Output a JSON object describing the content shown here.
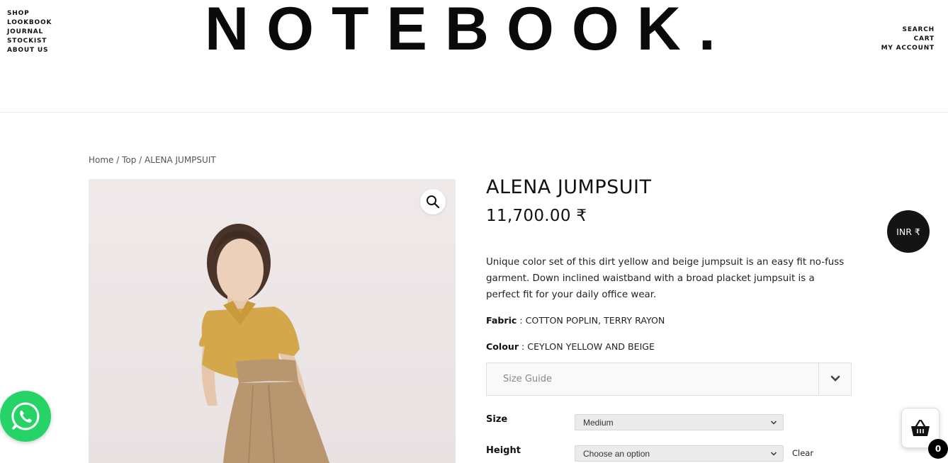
{
  "header": {
    "logo": "NOTEBOOK.",
    "nav_left": [
      "SHOP",
      "LOOKBOOK",
      "JOURNAL",
      "STOCKIST",
      "ABOUT US"
    ],
    "nav_right": [
      "SEARCH",
      "CART",
      "MY ACCOUNT"
    ]
  },
  "breadcrumb": {
    "home": "Home",
    "separator": " / ",
    "category": "Top",
    "current": "ALENA JUMPSUIT"
  },
  "product": {
    "title": "ALENA JUMPSUIT",
    "price": "11,700.00 ₹",
    "description": "Unique color set of this dirt yellow and beige jumpsuit is an easy fit no-fuss garment. Down inclined waistband with a broad placket jumpsuit is a perfect fit for your daily office wear.",
    "fabric_label": "Fabric",
    "fabric_value": " : COTTON POPLIN, TERRY RAYON",
    "colour_label": "Colour",
    "colour_value": " : CEYLON YELLOW AND BEIGE",
    "size_guide_label": "Size Guide",
    "size_label": "Size",
    "size_selected": "Medium",
    "height_label": "Height",
    "height_selected": "Choose an option",
    "clear_label": "Clear"
  },
  "widgets": {
    "currency_label": "INR ₹",
    "cart_count": "0"
  },
  "colors": {
    "whatsapp_green": "#25d366",
    "shirt_mustard": "#d4a84a",
    "pants_tan": "#b8966f"
  },
  "icons": {
    "zoom": "magnifier-icon",
    "whatsapp": "whatsapp-icon",
    "cart": "basket-icon",
    "chevron": "chevron-down-icon"
  }
}
